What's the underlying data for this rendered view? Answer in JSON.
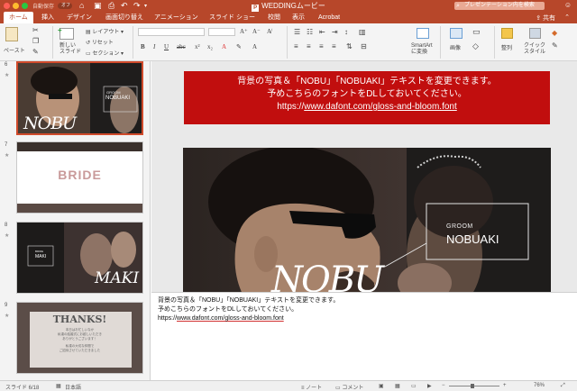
{
  "titlebar": {
    "autosave_label": "自動保存",
    "autosave_state": "オフ",
    "doc_title": "WEDDINGムービー",
    "search_placeholder": "プレゼンテーション内を検索"
  },
  "tabs": [
    {
      "label": "ホーム",
      "active": true
    },
    {
      "label": "挿入"
    },
    {
      "label": "デザイン"
    },
    {
      "label": "画面切り替え"
    },
    {
      "label": "アニメーション"
    },
    {
      "label": "スライド ショー"
    },
    {
      "label": "校閲"
    },
    {
      "label": "表示"
    },
    {
      "label": "Acrobat"
    }
  ],
  "share_label": "共有",
  "ribbon": {
    "paste": "ペースト",
    "new_slide": "新しい\nスライド",
    "layout": "レイアウト",
    "reset": "リセット",
    "section": "セクション",
    "smartart": "SmartArt\nに変換",
    "image": "画像",
    "arrange": "整列",
    "quick_style": "クイック\nスタイル"
  },
  "thumbnails": [
    {
      "number": "6",
      "big_text": "NOBU",
      "small_label": "GROOM",
      "name": "NOBUAKI"
    },
    {
      "number": "7",
      "big_text": "BRIDE"
    },
    {
      "number": "8",
      "big_text": "MAKI",
      "small_label": "BRIDE",
      "name": "MAKI"
    },
    {
      "number": "9",
      "title": "THANKS!",
      "line1": "本日はお忙しいなか",
      "line2": "私達の結婚式にお越しいただき",
      "line3": "ありがとうございます！",
      "line4": "私達の大切な仲間で",
      "line5": "ご招待させていただきました"
    }
  ],
  "slide": {
    "banner_line1": "背景の写真＆「NOBU」「NOBUAKI」テキストを変更できます。",
    "banner_line2": "予めこちらのフォントをDLしておいてください。",
    "banner_url_prefix": "https://",
    "banner_url": "www.dafont.com/gloss-and-bloom.font",
    "groom_label": "GROOM",
    "groom_name": "NOBUAKI",
    "script_text": "NOBU"
  },
  "notes": {
    "line1": "背景の写真＆「NOBU」「NOBUAKI」テキストを変更できます。",
    "line2": "予めこちらのフォントをDLしておいてください。",
    "url_prefix": "https://",
    "url": "www.dafont.com/gloss-and-bloom.font"
  },
  "status": {
    "slide_position": "スライド 6/18",
    "language": "日本語",
    "notes_label": "ノート",
    "comments_label": "コメント",
    "zoom": "76%"
  }
}
